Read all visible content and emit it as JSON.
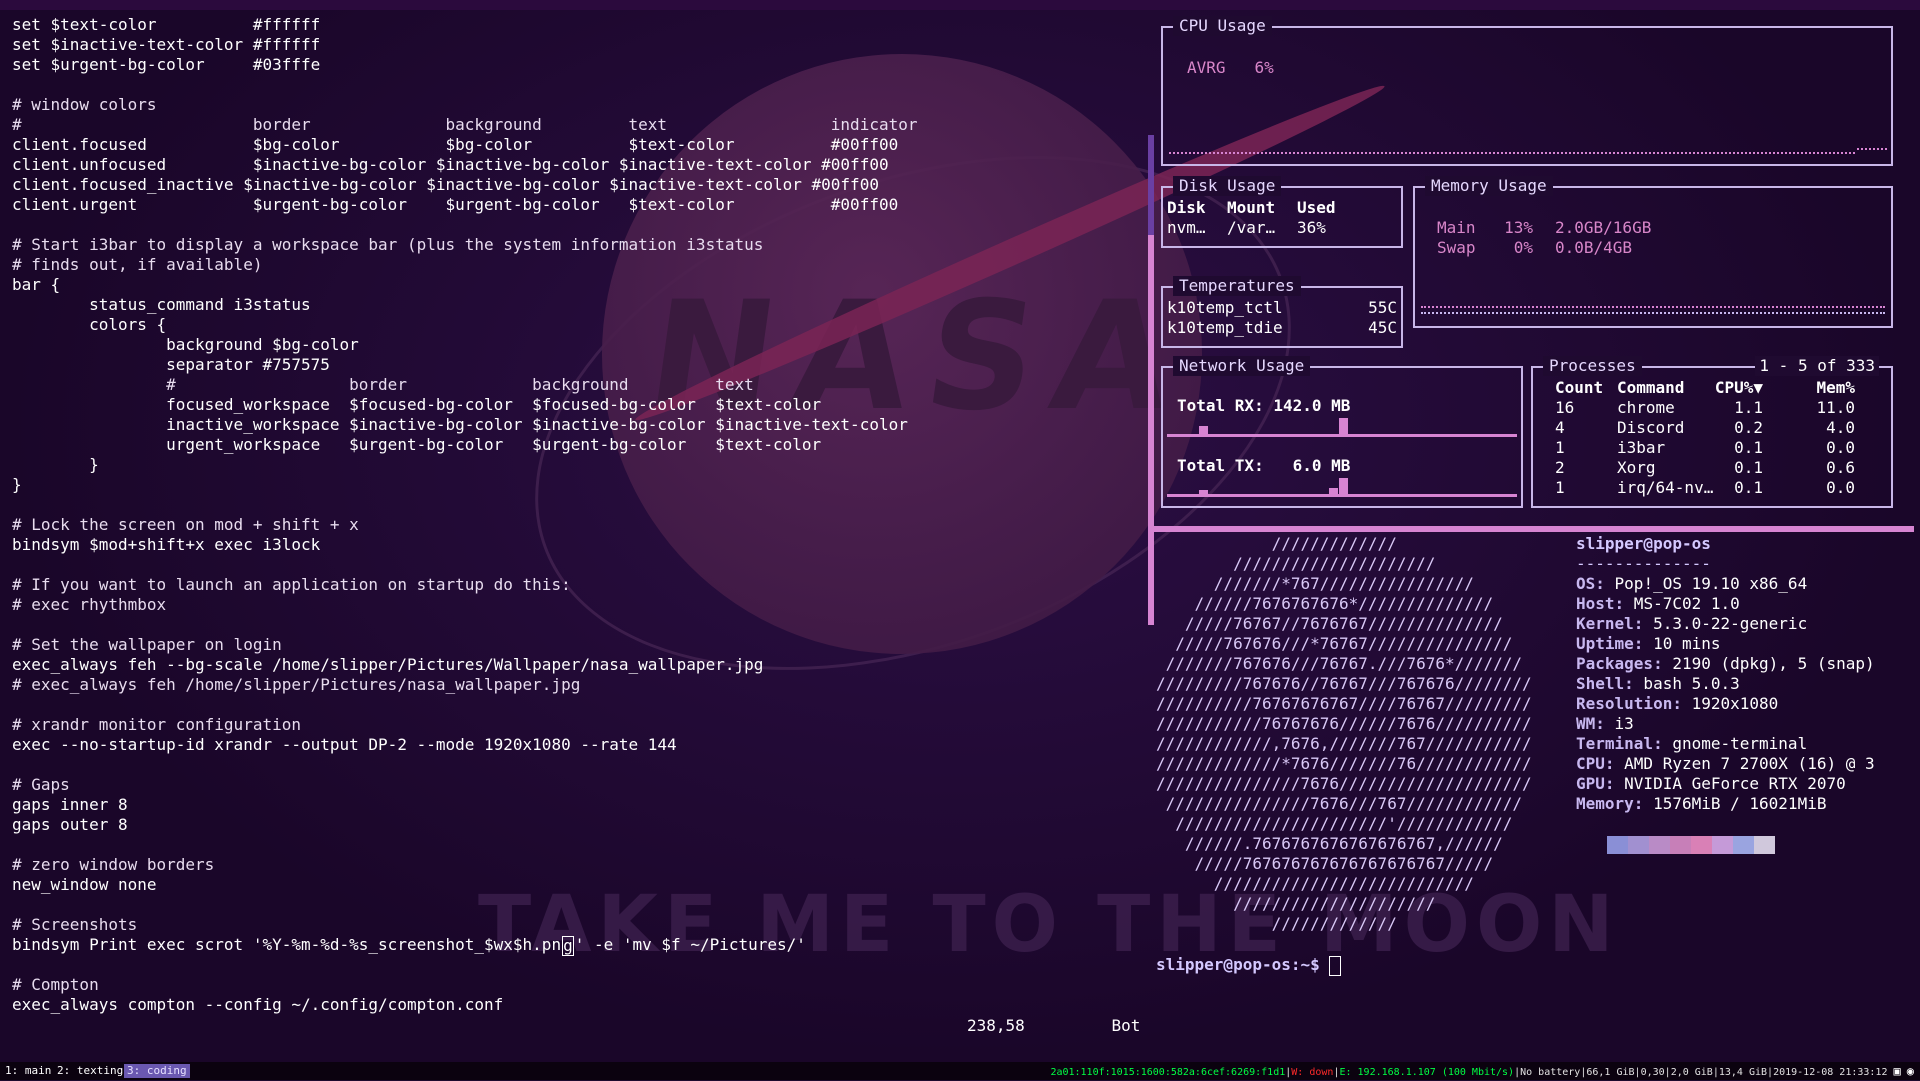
{
  "wallpaper": {
    "logo_text": "NASA",
    "tagline": "TAKE ME TO THE MOON"
  },
  "editor": {
    "lines": [
      "set $text-color          #ffffff",
      "set $inactive-text-color #ffffff",
      "set $urgent-bg-color     #03fffe",
      "",
      "# window colors",
      "#                        border              background         text                 indicator",
      "client.focused           $bg-color           $bg-color          $text-color          #00ff00",
      "client.unfocused         $inactive-bg-color $inactive-bg-color $inactive-text-color #00ff00",
      "client.focused_inactive $inactive-bg-color $inactive-bg-color $inactive-text-color #00ff00",
      "client.urgent            $urgent-bg-color    $urgent-bg-color   $text-color          #00ff00",
      "",
      "# Start i3bar to display a workspace bar (plus the system information i3status",
      "# finds out, if available)",
      "bar {",
      "        status_command i3status",
      "        colors {",
      "                background $bg-color",
      "                separator #757575",
      "                #                  border             background         text",
      "                focused_workspace  $focused-bg-color  $focused-bg-color  $text-color",
      "                inactive_workspace $inactive-bg-color $inactive-bg-color $inactive-text-color",
      "                urgent_workspace   $urgent-bg-color   $urgent-bg-color   $text-color",
      "        }",
      "}",
      "",
      "# Lock the screen on mod + shift + x",
      "bindsym $mod+shift+x exec i3lock",
      "",
      "# If you want to launch an application on startup do this:",
      "# exec rhythmbox",
      "",
      "# Set the wallpaper on login",
      "exec_always feh --bg-scale /home/slipper/Pictures/Wallpaper/nasa_wallpaper.jpg",
      "# exec_always feh /home/slipper/Pictures/nasa_wallpaper.jpg",
      "",
      "# xrandr monitor configuration",
      "exec --no-startup-id xrandr --output DP-2 --mode 1920x1080 --rate 144",
      "",
      "# Gaps",
      "gaps inner 8",
      "gaps outer 8",
      "",
      "# zero window borders",
      "new_window none",
      "",
      "# Screenshots",
      "",
      "",
      "# Compton",
      "exec_always compton --config ~/.config/compton.conf"
    ],
    "scrot_before": "bindsym Print exec scrot '%Y-%m-%d-%s_screenshot_$wx$h.pn",
    "scrot_cursor": "g",
    "scrot_after": "' -e 'mv $f ~/Pictures/'",
    "position": "238,58",
    "scroll": "Bot"
  },
  "cpu": {
    "title": "CPU Usage",
    "label": "AVRG",
    "value": "6%"
  },
  "disk": {
    "title": "Disk Usage",
    "headers": [
      "Disk",
      "Mount",
      "Used"
    ],
    "row": [
      "nvm…",
      "/var…",
      "36%"
    ]
  },
  "memory": {
    "title": "Memory Usage",
    "rows": [
      {
        "label": "Main",
        "pct": "13%",
        "amount": "2.0GB/16GB"
      },
      {
        "label": "Swap",
        "pct": "0%",
        "amount": "0.0B/4GB"
      }
    ]
  },
  "temps": {
    "title": "Temperatures",
    "rows": [
      {
        "name": "k10temp_tctl",
        "value": "55C"
      },
      {
        "name": "k10temp_tdie",
        "value": "45C"
      }
    ]
  },
  "network": {
    "title": "Network Usage",
    "rx_label": "Total RX:",
    "rx_value": "142.0 MB",
    "tx_label": "Total TX:",
    "tx_value": "6.0 MB"
  },
  "processes": {
    "title": "Processes",
    "range": "1 - 5 of 333",
    "headers": [
      "Count",
      "Command",
      "CPU%▼",
      "Mem%"
    ],
    "rows": [
      [
        "16",
        "chrome",
        "1.1",
        "11.0"
      ],
      [
        "4",
        "Discord",
        "0.2",
        "4.0"
      ],
      [
        "1",
        "i3bar",
        "0.1",
        "0.0"
      ],
      [
        "2",
        "Xorg",
        "0.1",
        "0.6"
      ],
      [
        "1",
        "irq/64-nv…",
        "0.1",
        "0.0"
      ]
    ]
  },
  "neofetch": {
    "logo_lines": [
      "            /////////////",
      "        /////////////////////",
      "      ///////*767////////////////",
      "    //////7676767676*//////////////",
      "   /////76767//7676767//////////////",
      "  /////767676///*76767///////////////",
      " ///////767676///76767.///7676*///////",
      "/////////767676//76767///767676////////",
      "//////////76767676767////76767/////////",
      "///////////76767676//////7676//////////",
      "////////////,7676,///////767///////////",
      "/////////////*7676///////76////////////",
      "///////////////7676////////////////////",
      " ///////////////7676///767////////////",
      "  //////////////////////'////////////",
      "   //////.7676767676767676767,//////",
      "    /////767676767676767676767/////",
      "      ///////////////////////////",
      "        /////////////////////",
      "            /////////////"
    ],
    "user_host": "slipper@pop-os",
    "separator": "--------------",
    "info": [
      {
        "key": "OS:",
        "value": " Pop!_OS 19.10 x86_64"
      },
      {
        "key": "Host:",
        "value": " MS-7C02 1.0"
      },
      {
        "key": "Kernel:",
        "value": " 5.3.0-22-generic"
      },
      {
        "key": "Uptime:",
        "value": " 10 mins"
      },
      {
        "key": "Packages:",
        "value": " 2190 (dpkg), 5 (snap)"
      },
      {
        "key": "Shell:",
        "value": " bash 5.0.3"
      },
      {
        "key": "Resolution:",
        "value": " 1920x1080"
      },
      {
        "key": "WM:",
        "value": " i3"
      },
      {
        "key": "Terminal:",
        "value": " gnome-terminal"
      },
      {
        "key": "CPU:",
        "value": " AMD Ryzen 7 2700X (16) @ 3"
      },
      {
        "key": "GPU:",
        "value": " NVIDIA GeForce RTX 2070"
      },
      {
        "key": "Memory:",
        "value": " 1576MiB / 16021MiB"
      }
    ],
    "swatches": [
      "#8a8fd6",
      "#a190d0",
      "#b98bc6",
      "#c77fb8",
      "#d980b6",
      "#c59ad8",
      "#9aa4e0",
      "#d0c8dc"
    ],
    "prompt": "slipper@pop-os:~$ "
  },
  "statusbar": {
    "workspaces": [
      "1: main",
      "2: texting",
      "3: coding"
    ],
    "ipv6": "2a01:110f:1015:1600:582a:6cef:6269:f1d1",
    "wifi": "W: down",
    "eth": "E: 192.168.1.107 (100 Mbit/s)",
    "battery": "No battery",
    "disk": "66,1 GiB",
    "load": "0,30",
    "mem": "2,0 GiB",
    "swap": "13,4 GiB",
    "datetime": "2019-12-08 21:33:12"
  }
}
